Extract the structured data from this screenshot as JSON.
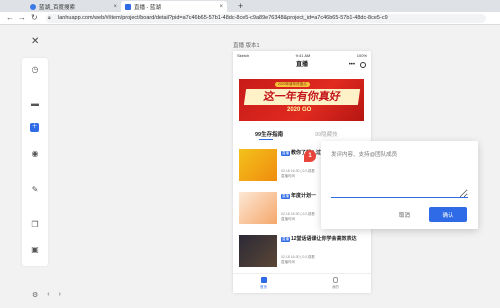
{
  "browser": {
    "tabs": [
      {
        "label": "蓝湖_百度搜索"
      },
      {
        "label": "直播 - 蓝湖"
      }
    ],
    "new_tab": "+",
    "url": "lanhuapp.com/web/#/item/project/board/detail?pid=a7c46b65-57b1-48dc-8ce5-c9a89e76348&project_id=a7c46b65-57b1-48dc-8ce5-c9"
  },
  "page": {
    "screen_label": "直播  版本1",
    "phone": {
      "status_left": "Sketch",
      "status_time": "9:41 AM",
      "status_right": "100%",
      "title": "直播",
      "banner_pill": "2020年度年终盘点",
      "banner_slogan": "这一年有你真好",
      "banner_year": "2020 GO",
      "tab_active": "99生存指南",
      "tab_inactive": "99隐藏技",
      "items": [
        {
          "tag": "直播",
          "title": "教你了解入过万",
          "meta1": "02.18 16:30 | 0人观看",
          "meta2": "直播时间"
        },
        {
          "tag": "直播",
          "title": "年度计划一",
          "meta1": "02.18 16:30 | 0人观看",
          "meta2": "直播时间"
        },
        {
          "tag": "直播",
          "title": "12堂话语课让你学会高效表达",
          "meta1": "02.18 16:30 | 0人观看",
          "meta2": "直播时间"
        }
      ],
      "tabbar": {
        "home": "首页",
        "me": "我的"
      }
    }
  },
  "marker": {
    "label": "1"
  },
  "dialog": {
    "placeholder": "发评内容、支持@团队成员",
    "cancel": "取消",
    "confirm": "确认"
  },
  "colors": {
    "accent": "#2f6be6",
    "banner_red": "#d8231c",
    "marker": "#e9443a"
  }
}
